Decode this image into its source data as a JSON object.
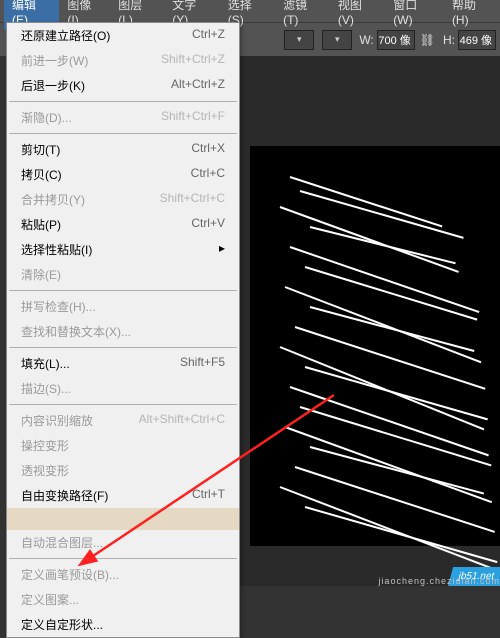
{
  "menubar": {
    "edit": "编辑(E)",
    "image": "图像(I)",
    "layer": "图层(L)",
    "type": "文字(Y)",
    "select": "选择(S)",
    "filter": "滤镜(T)",
    "view": "视图(V)",
    "window": "窗口(W)",
    "help": "帮助(H)"
  },
  "toolbar": {
    "w_label": "W:",
    "w_value": "700 像",
    "h_label": "H:",
    "h_value": "469 像",
    "link_icon": "⛓"
  },
  "menu": {
    "undo": {
      "label": "还原建立路径(O)",
      "sc": "Ctrl+Z"
    },
    "forward": {
      "label": "前进一步(W)",
      "sc": "Shift+Ctrl+Z"
    },
    "back": {
      "label": "后退一步(K)",
      "sc": "Alt+Ctrl+Z"
    },
    "fade": {
      "label": "渐隐(D)...",
      "sc": "Shift+Ctrl+F"
    },
    "cut": {
      "label": "剪切(T)",
      "sc": "Ctrl+X"
    },
    "copy": {
      "label": "拷贝(C)",
      "sc": "Ctrl+C"
    },
    "copymerged": {
      "label": "合并拷贝(Y)",
      "sc": "Shift+Ctrl+C"
    },
    "paste": {
      "label": "粘贴(P)",
      "sc": "Ctrl+V"
    },
    "pastespecial": {
      "label": "选择性粘贴(I)"
    },
    "clear": {
      "label": "清除(E)"
    },
    "spell": {
      "label": "拼写检查(H)..."
    },
    "findreplace": {
      "label": "查找和替换文本(X)..."
    },
    "fill": {
      "label": "填充(L)...",
      "sc": "Shift+F5"
    },
    "stroke": {
      "label": "描边(S)..."
    },
    "contentaware": {
      "label": "内容识别缩放",
      "sc": "Alt+Shift+Ctrl+C"
    },
    "puppet": {
      "label": "操控变形"
    },
    "perspective": {
      "label": "透视变形"
    },
    "freetransform": {
      "label": "自由变换路径(F)",
      "sc": "Ctrl+T"
    },
    "autoblend": {
      "label": "自动混合图层..."
    },
    "brushpreset": {
      "label": "定义画笔预设(B)..."
    },
    "pattern": {
      "label": "定义图案..."
    },
    "customshape": {
      "label": "定义自定形状..."
    }
  },
  "watermark": {
    "site": "jb51.net",
    "url": "jiaocheng.chezidian.com"
  }
}
